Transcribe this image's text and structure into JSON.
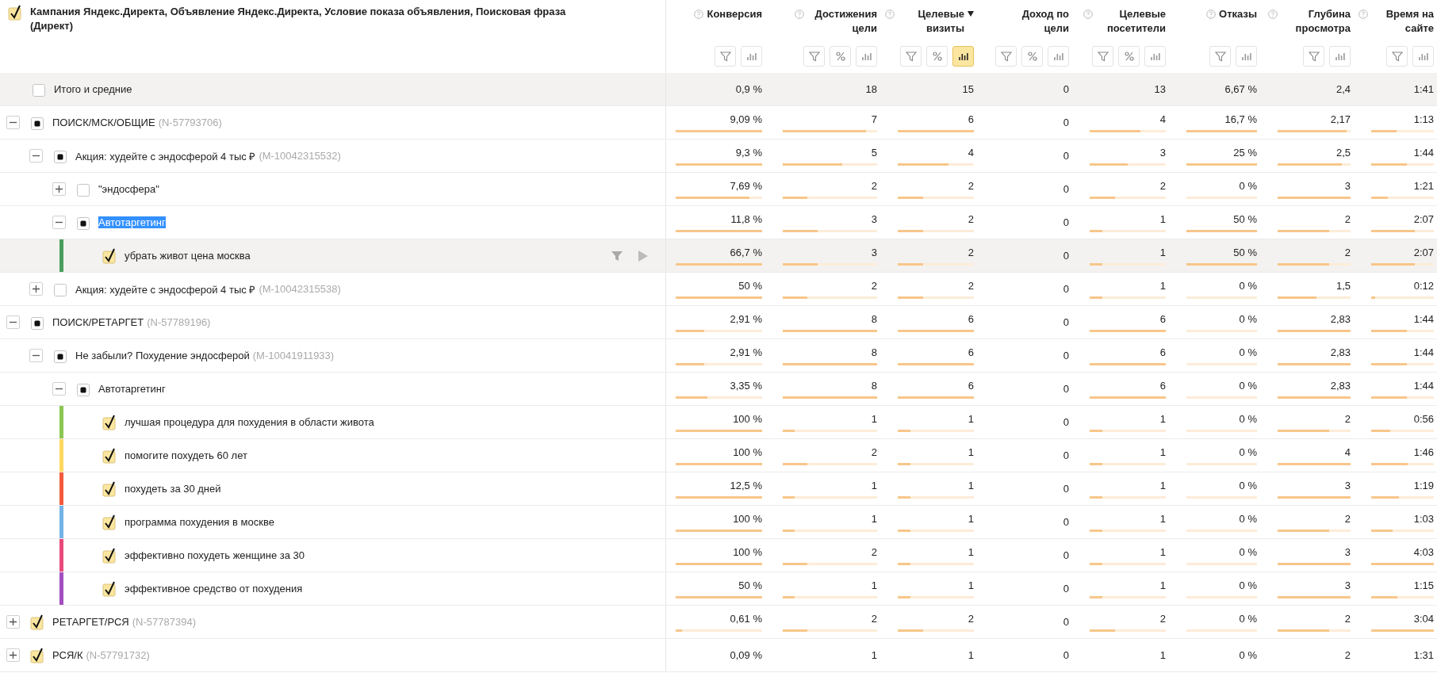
{
  "header": {
    "checked": true,
    "indeterminate": false,
    "title": "Кампания Яндекс.Директа, Объявление Яндекс.Директа, Условие показа объявления, Поисковая фраза (Директ)"
  },
  "columns": [
    {
      "title": "Конверсия",
      "help": true,
      "sorted": false,
      "tools": [
        {
          "kind": "filter",
          "on": false
        },
        {
          "kind": "chart",
          "on": false
        }
      ]
    },
    {
      "title": "Достижения цели",
      "help": true,
      "sorted": false,
      "tools": [
        {
          "kind": "filter",
          "on": false
        },
        {
          "kind": "percent",
          "on": false
        },
        {
          "kind": "chart",
          "on": false
        }
      ]
    },
    {
      "title": "Целевые визиты",
      "help": true,
      "sorted": true,
      "tools": [
        {
          "kind": "filter",
          "on": false
        },
        {
          "kind": "percent",
          "on": false
        },
        {
          "kind": "chart",
          "on": true
        }
      ]
    },
    {
      "title": "Доход по цели",
      "help": false,
      "sorted": false,
      "tools": [
        {
          "kind": "filter",
          "on": false
        },
        {
          "kind": "percent",
          "on": false
        },
        {
          "kind": "chart",
          "on": false
        }
      ]
    },
    {
      "title": "Целевые посетители",
      "help": true,
      "sorted": false,
      "tools": [
        {
          "kind": "filter",
          "on": false
        },
        {
          "kind": "percent",
          "on": false
        },
        {
          "kind": "chart",
          "on": false
        }
      ]
    },
    {
      "title": "Отказы",
      "help": true,
      "sorted": false,
      "tools": [
        {
          "kind": "filter",
          "on": false
        },
        {
          "kind": "chart",
          "on": false
        }
      ]
    },
    {
      "title": "Глубина просмотра",
      "help": true,
      "sorted": false,
      "tools": [
        {
          "kind": "filter",
          "on": false
        },
        {
          "kind": "chart",
          "on": false
        }
      ]
    },
    {
      "title": "Время на сайте",
      "help": true,
      "sorted": false,
      "tools": [
        {
          "kind": "filter",
          "on": false
        },
        {
          "kind": "chart",
          "on": false
        }
      ]
    }
  ],
  "totals": {
    "label": "Итого и средние",
    "checked": false,
    "indeterminate": false,
    "cells": [
      "0,9 %",
      "18",
      "15",
      "0",
      "13",
      "6,67 %",
      "2,4",
      "1:41"
    ]
  },
  "rows": [
    {
      "name": "ПОИСК/МСК/ОБЩИЕ",
      "id": "(N-57793706)",
      "checked": false,
      "indeterminate": true,
      "expanded": true,
      "selected": false,
      "text_selected": false,
      "cells": [
        {
          "text": "9,09 %",
          "level": 1
        },
        {
          "text": "7",
          "level": 0.88
        },
        {
          "text": "6",
          "level": 1
        },
        {
          "text": "0"
        },
        {
          "text": "4",
          "level": 0.67
        },
        {
          "text": "16,7 %",
          "level": 1
        },
        {
          "text": "2,17",
          "level": 0.95
        },
        {
          "text": "1:13",
          "level": 0.41
        }
      ],
      "children": [
        {
          "name": "Акция: худейте с эндосферой 4 тыс ₽",
          "id": "(M-10042315532)",
          "checked": false,
          "indeterminate": true,
          "expanded": true,
          "selected": false,
          "text_selected": false,
          "cells": [
            {
              "text": "9,3 %",
              "level": 1
            },
            {
              "text": "5",
              "level": 0.63
            },
            {
              "text": "4",
              "level": 0.67
            },
            {
              "text": "0"
            },
            {
              "text": "3",
              "level": 0.5
            },
            {
              "text": "25 %",
              "level": 1
            },
            {
              "text": "2,5",
              "level": 0.88
            },
            {
              "text": "1:44",
              "level": 0.57
            }
          ],
          "children": [
            {
              "name": "\"эндосфера\"",
              "checked": false,
              "indeterminate": false,
              "expanded": false,
              "selected": false,
              "text_selected": false,
              "cells": [
                {
                  "text": "7,69 %",
                  "level": 0.85
                },
                {
                  "text": "2",
                  "level": 0.26
                },
                {
                  "text": "2",
                  "level": 0.33
                },
                {
                  "text": "0"
                },
                {
                  "text": "2",
                  "level": 0.33
                },
                {
                  "text": "0 %",
                  "level": 0
                },
                {
                  "text": "3",
                  "level": 1
                },
                {
                  "text": "1:21",
                  "level": 0.26
                }
              ]
            },
            {
              "name": "Автотаргетинг",
              "checked": false,
              "indeterminate": true,
              "expanded": true,
              "selected": false,
              "text_selected": true,
              "cells": [
                {
                  "text": "11,8 %",
                  "level": 1
                },
                {
                  "text": "3",
                  "level": 0.37
                },
                {
                  "text": "2",
                  "level": 0.33
                },
                {
                  "text": "0"
                },
                {
                  "text": "1",
                  "level": 0.17
                },
                {
                  "text": "50 %",
                  "level": 1
                },
                {
                  "text": "2",
                  "level": 0.71
                },
                {
                  "text": "2:07",
                  "level": 0.7
                }
              ],
              "children": [
                {
                  "name": "убрать живот цена москва",
                  "checked": true,
                  "indeterminate": false,
                  "color": "#4a9e5c",
                  "selected": true,
                  "text_selected": false,
                  "cells": [
                    {
                      "text": "66,7 %",
                      "level": 1
                    },
                    {
                      "text": "3",
                      "level": 0.37
                    },
                    {
                      "text": "2",
                      "level": 0.33
                    },
                    {
                      "text": "0"
                    },
                    {
                      "text": "1",
                      "level": 0.17
                    },
                    {
                      "text": "50 %",
                      "level": 1
                    },
                    {
                      "text": "2",
                      "level": 0.71
                    },
                    {
                      "text": "2:07",
                      "level": 0.7
                    }
                  ]
                }
              ]
            }
          ]
        },
        {
          "name": "Акция: худейте с эндосферой 4 тыс ₽",
          "id": "(M-10042315538)",
          "checked": false,
          "indeterminate": false,
          "expanded": false,
          "selected": false,
          "text_selected": false,
          "cells": [
            {
              "text": "50 %",
              "level": 1
            },
            {
              "text": "2",
              "level": 0.26
            },
            {
              "text": "2",
              "level": 0.33
            },
            {
              "text": "0"
            },
            {
              "text": "1",
              "level": 0.17
            },
            {
              "text": "0 %",
              "level": 0
            },
            {
              "text": "1,5",
              "level": 0.53
            },
            {
              "text": "0:12",
              "level": 0.06
            }
          ]
        }
      ]
    },
    {
      "name": "ПОИСК/РЕТАРГЕТ",
      "id": "(N-57789196)",
      "checked": false,
      "indeterminate": true,
      "expanded": true,
      "selected": false,
      "text_selected": false,
      "cells": [
        {
          "text": "2,91 %",
          "level": 0.33
        },
        {
          "text": "8",
          "level": 1
        },
        {
          "text": "6",
          "level": 1
        },
        {
          "text": "0"
        },
        {
          "text": "6",
          "level": 1
        },
        {
          "text": "0 %",
          "level": 0
        },
        {
          "text": "2,83",
          "level": 1
        },
        {
          "text": "1:44",
          "level": 0.57
        }
      ],
      "children": [
        {
          "name": "Не забыли? Похудение эндосферой",
          "id": "(M-10041911933)",
          "checked": false,
          "indeterminate": true,
          "expanded": true,
          "selected": false,
          "text_selected": false,
          "cells": [
            {
              "text": "2,91 %",
              "level": 0.33
            },
            {
              "text": "8",
              "level": 1
            },
            {
              "text": "6",
              "level": 1
            },
            {
              "text": "0"
            },
            {
              "text": "6",
              "level": 1
            },
            {
              "text": "0 %",
              "level": 0
            },
            {
              "text": "2,83",
              "level": 1
            },
            {
              "text": "1:44",
              "level": 0.57
            }
          ],
          "children": [
            {
              "name": "Автотаргетинг",
              "checked": false,
              "indeterminate": true,
              "expanded": true,
              "selected": false,
              "text_selected": false,
              "cells": [
                {
                  "text": "3,35 %",
                  "level": 0.37
                },
                {
                  "text": "8",
                  "level": 1
                },
                {
                  "text": "6",
                  "level": 1
                },
                {
                  "text": "0"
                },
                {
                  "text": "6",
                  "level": 1
                },
                {
                  "text": "0 %",
                  "level": 0
                },
                {
                  "text": "2,83",
                  "level": 1
                },
                {
                  "text": "1:44",
                  "level": 0.57
                }
              ],
              "children": [
                {
                  "name": "лучшая процедура для похудения в области живота",
                  "checked": true,
                  "indeterminate": false,
                  "color": "#8bc553",
                  "selected": false,
                  "text_selected": false,
                  "cells": [
                    {
                      "text": "100 %",
                      "level": 1
                    },
                    {
                      "text": "1",
                      "level": 0.13
                    },
                    {
                      "text": "1",
                      "level": 0.17
                    },
                    {
                      "text": "0"
                    },
                    {
                      "text": "1",
                      "level": 0.17
                    },
                    {
                      "text": "0 %",
                      "level": 0
                    },
                    {
                      "text": "2",
                      "level": 0.71
                    },
                    {
                      "text": "0:56",
                      "level": 0.3
                    }
                  ]
                },
                {
                  "name": "помогите похудеть 60 лет",
                  "checked": true,
                  "indeterminate": false,
                  "color": "#ffd75e",
                  "selected": false,
                  "text_selected": false,
                  "cells": [
                    {
                      "text": "100 %",
                      "level": 1
                    },
                    {
                      "text": "2",
                      "level": 0.26
                    },
                    {
                      "text": "1",
                      "level": 0.17
                    },
                    {
                      "text": "0"
                    },
                    {
                      "text": "1",
                      "level": 0.17
                    },
                    {
                      "text": "0 %",
                      "level": 0
                    },
                    {
                      "text": "4",
                      "level": 1
                    },
                    {
                      "text": "1:46",
                      "level": 0.58
                    }
                  ]
                },
                {
                  "name": "похудеть за 30 дней",
                  "checked": true,
                  "indeterminate": false,
                  "color": "#f45a3c",
                  "selected": false,
                  "text_selected": false,
                  "cells": [
                    {
                      "text": "12,5 %",
                      "level": 1
                    },
                    {
                      "text": "1",
                      "level": 0.13
                    },
                    {
                      "text": "1",
                      "level": 0.17
                    },
                    {
                      "text": "0"
                    },
                    {
                      "text": "1",
                      "level": 0.17
                    },
                    {
                      "text": "0 %",
                      "level": 0
                    },
                    {
                      "text": "3",
                      "level": 1
                    },
                    {
                      "text": "1:19",
                      "level": 0.44
                    }
                  ]
                },
                {
                  "name": "программа похудения в москве",
                  "checked": true,
                  "indeterminate": false,
                  "color": "#74b3e6",
                  "selected": false,
                  "text_selected": false,
                  "cells": [
                    {
                      "text": "100 %",
                      "level": 1
                    },
                    {
                      "text": "1",
                      "level": 0.13
                    },
                    {
                      "text": "1",
                      "level": 0.17
                    },
                    {
                      "text": "0"
                    },
                    {
                      "text": "1",
                      "level": 0.17
                    },
                    {
                      "text": "0 %",
                      "level": 0
                    },
                    {
                      "text": "2",
                      "level": 0.71
                    },
                    {
                      "text": "1:03",
                      "level": 0.34
                    }
                  ]
                },
                {
                  "name": "эффективно похудеть женщине за 30",
                  "checked": true,
                  "indeterminate": false,
                  "color": "#e84a7b",
                  "selected": false,
                  "text_selected": false,
                  "cells": [
                    {
                      "text": "100 %",
                      "level": 1
                    },
                    {
                      "text": "2",
                      "level": 0.26
                    },
                    {
                      "text": "1",
                      "level": 0.17
                    },
                    {
                      "text": "0"
                    },
                    {
                      "text": "1",
                      "level": 0.17
                    },
                    {
                      "text": "0 %",
                      "level": 0
                    },
                    {
                      "text": "3",
                      "level": 1
                    },
                    {
                      "text": "4:03",
                      "level": 1
                    }
                  ]
                },
                {
                  "name": "эффективное средство от похудения",
                  "checked": true,
                  "indeterminate": false,
                  "color": "#a24ec0",
                  "selected": false,
                  "text_selected": false,
                  "cells": [
                    {
                      "text": "50 %",
                      "level": 1
                    },
                    {
                      "text": "1",
                      "level": 0.13
                    },
                    {
                      "text": "1",
                      "level": 0.17
                    },
                    {
                      "text": "0"
                    },
                    {
                      "text": "1",
                      "level": 0.17
                    },
                    {
                      "text": "0 %",
                      "level": 0
                    },
                    {
                      "text": "3",
                      "level": 1
                    },
                    {
                      "text": "1:15",
                      "level": 0.42
                    }
                  ]
                }
              ]
            }
          ]
        }
      ]
    },
    {
      "name": "РЕТАРГЕТ/РСЯ",
      "id": "(N-57787394)",
      "checked": true,
      "indeterminate": false,
      "expanded": false,
      "selected": false,
      "text_selected": false,
      "cells": [
        {
          "text": "0,61 %",
          "level": 0.07
        },
        {
          "text": "2",
          "level": 0.26
        },
        {
          "text": "2",
          "level": 0.33
        },
        {
          "text": "0"
        },
        {
          "text": "2",
          "level": 0.33
        },
        {
          "text": "0 %",
          "level": 0
        },
        {
          "text": "2",
          "level": 0.71
        },
        {
          "text": "3:04",
          "level": 1
        }
      ]
    },
    {
      "name": "РСЯ/К",
      "id": "(N-57791732)",
      "checked": true,
      "indeterminate": false,
      "expanded": false,
      "selected": false,
      "text_selected": false,
      "cells": [
        {
          "text": "0,09 %"
        },
        {
          "text": "1"
        },
        {
          "text": "1"
        },
        {
          "text": "0"
        },
        {
          "text": "1"
        },
        {
          "text": "0 %"
        },
        {
          "text": "2"
        },
        {
          "text": "1:31"
        }
      ]
    }
  ]
}
